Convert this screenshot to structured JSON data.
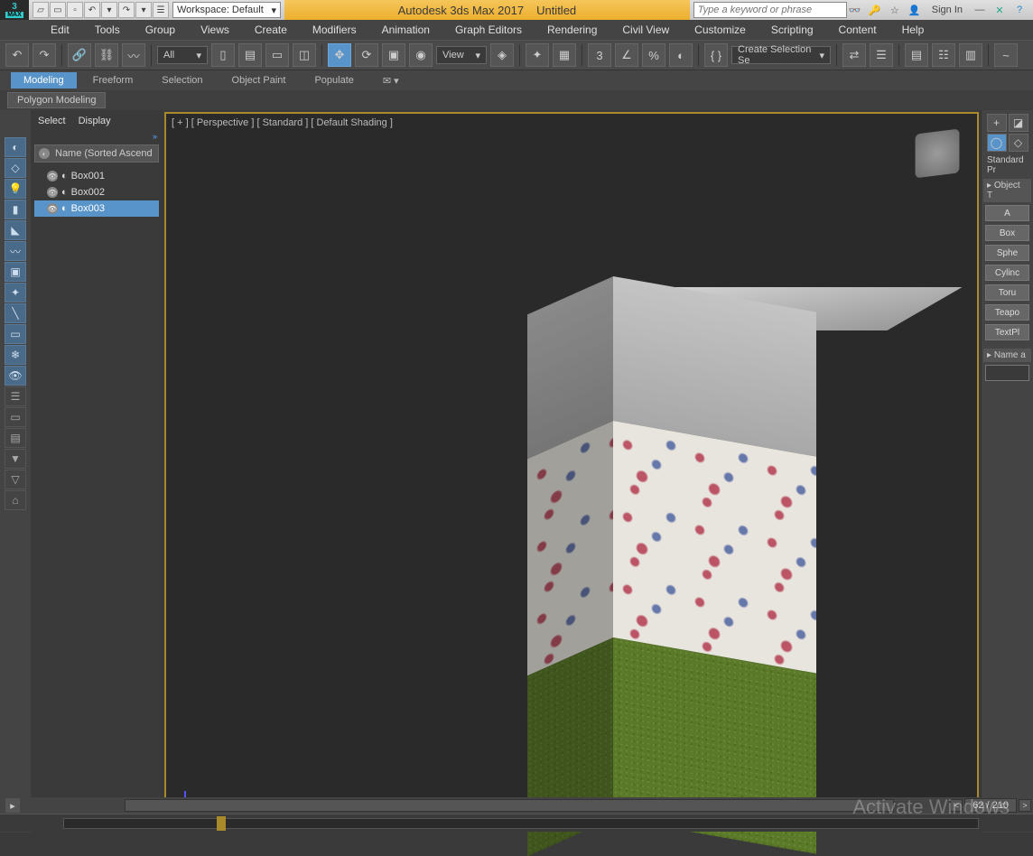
{
  "titlebar": {
    "workspace_label": "Workspace: Default",
    "app_title": "Autodesk 3ds Max 2017",
    "doc_title": "Untitled",
    "search_placeholder": "Type a keyword or phrase",
    "sign_in": "Sign In"
  },
  "menus": [
    "Edit",
    "Tools",
    "Group",
    "Views",
    "Create",
    "Modifiers",
    "Animation",
    "Graph Editors",
    "Rendering",
    "Civil View",
    "Customize",
    "Scripting",
    "Content",
    "Help"
  ],
  "toolbar": {
    "all_dd": "All",
    "view_dd": "View",
    "create_sel_dd": "Create Selection Se"
  },
  "ribbon": {
    "tabs": [
      "Modeling",
      "Freeform",
      "Selection",
      "Object Paint",
      "Populate"
    ],
    "active_index": 0,
    "subtab": "Polygon Modeling"
  },
  "scene_explorer": {
    "tabs": [
      "Select",
      "Display"
    ],
    "header": "Name (Sorted Ascend",
    "items": [
      "Box001",
      "Box002",
      "Box003"
    ],
    "selected_index": 2
  },
  "viewport": {
    "labels": "[ + ] [ Perspective ] [ Standard ] [ Default Shading ]"
  },
  "command_panel": {
    "header": "Standard Pr",
    "rollout1": "Object T",
    "buttons": [
      "A",
      "Box",
      "Sphe",
      "Cylinc",
      "Toru",
      "Teapo",
      "TextPl"
    ],
    "rollout2": "Name a"
  },
  "status": {
    "frame": "62 / 210"
  },
  "watermark": "Activate Windows"
}
